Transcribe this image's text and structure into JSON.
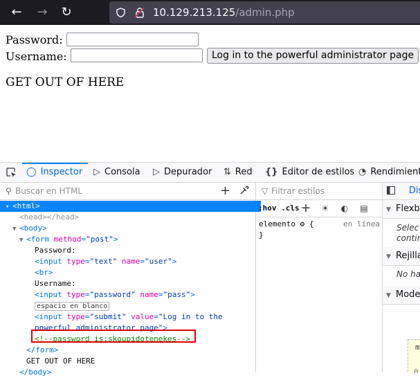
{
  "browser": {
    "url_host": "10.129.213.125",
    "url_path": "/admin.php",
    "back_icon": "arrow-left-icon",
    "forward_icon": "arrow-right-icon",
    "reload_icon": "reload-icon"
  },
  "page": {
    "password_label": "Password:",
    "username_label": "Username:",
    "submit_label": "Log in to the powerful administrator page",
    "message": "GET OUT OF HERE"
  },
  "devtools": {
    "tabs": [
      {
        "label": "Inspector",
        "icon": "inspector-icon"
      },
      {
        "label": "Consola",
        "icon": "console-icon"
      },
      {
        "label": "Depurador",
        "icon": "debugger-icon"
      },
      {
        "label": "Red",
        "icon": "network-icon"
      },
      {
        "label": "Editor de estilos",
        "icon": "style-editor-icon"
      },
      {
        "label": "Rendimient",
        "icon": "performance-icon"
      }
    ],
    "search_placeholder": "Buscar en HTML",
    "tree": {
      "html_open": "<html>",
      "head": "<head></head>",
      "body_open": "<body>",
      "form_open_tag": "<form",
      "form_attr": "method",
      "form_val": "\"post\"",
      "form_close_bracket": ">",
      "text_password": "Password:",
      "input1_tag": "<input",
      "input1_attr1": "type",
      "input1_val1": "\"text\"",
      "input1_attr2": "name",
      "input1_val2": "\"user\"",
      "input1_end": ">",
      "br": "<br>",
      "text_username": "Username:",
      "input2_tag": "<input",
      "input2_attr1": "type",
      "input2_val1": "\"password\"",
      "input2_attr2": "name",
      "input2_val2": "\"pass\"",
      "input2_end": ">",
      "whitespace_badge": "espacio en blanco",
      "input3_tag": "<input",
      "input3_attr1": "type",
      "input3_val1": "\"submit\"",
      "input3_attr2": "value",
      "input3_val2a": "\"Log in to the",
      "input3_val2b": "powerful administrator page\"",
      "input3_end": ">",
      "comment": "<!--password is:skoupidotenekes-->",
      "form_close": "</form>",
      "text_get_out": "GET OUT OF HERE",
      "body_close": "</body>"
    },
    "rules": {
      "filter_placeholder": "Filtrar estilos",
      "hov_cls": ":hov .cls",
      "selector": "elemento",
      "brace_open": "{",
      "brace_close": "}",
      "source": "en línea"
    },
    "layout": {
      "tab_label": "Dis",
      "flexbox": "Flexbo",
      "flexbox_note_1": "Selec",
      "flexbox_note_2": "contin",
      "grid": "Rejilla",
      "grid_note": "No ha",
      "model": "Model",
      "box_m": "m",
      "box_zero": "0"
    }
  }
}
